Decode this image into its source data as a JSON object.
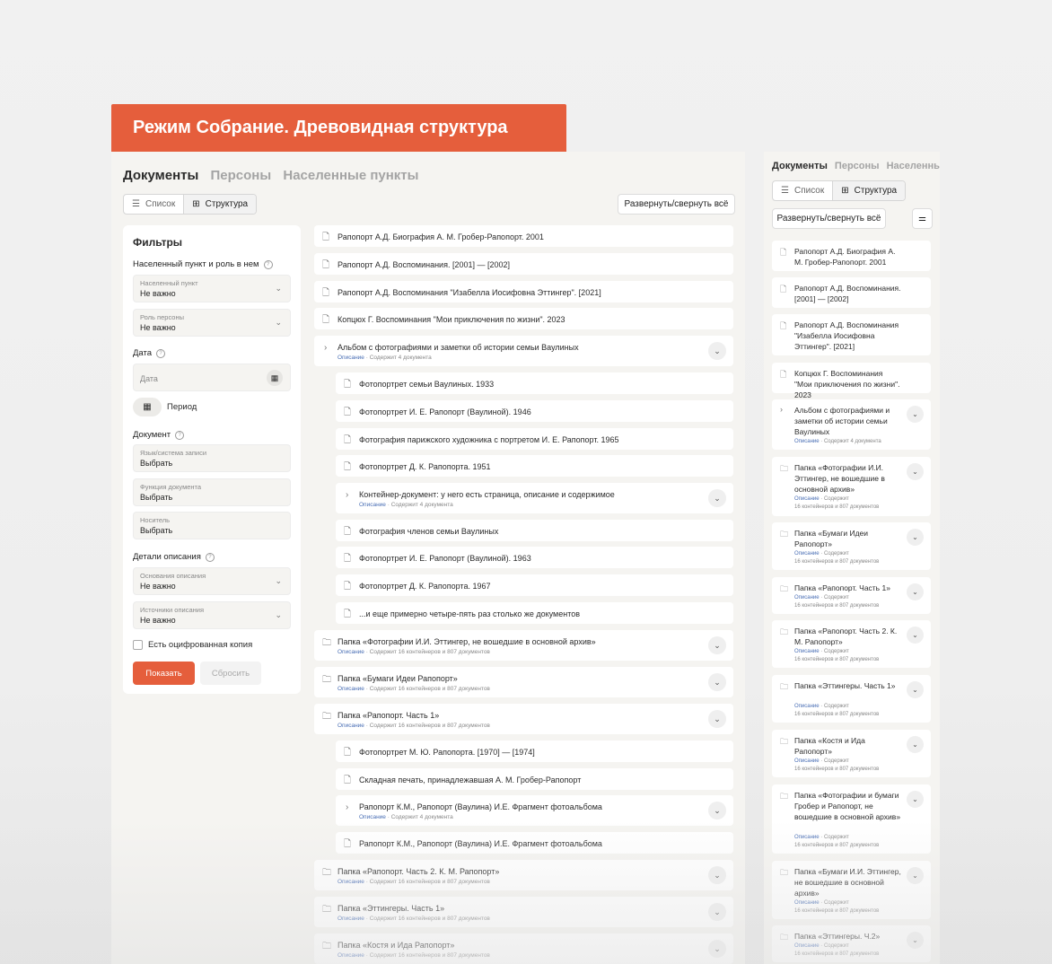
{
  "banner": {
    "title": "Режим Собрание. Древовидная структура"
  },
  "tabs": [
    "Документы",
    "Персоны",
    "Населенные пункты"
  ],
  "view_toggle": {
    "list": "Список",
    "structure": "Структура"
  },
  "expand_all": "Развернуть/свернуть всё",
  "filters": {
    "title": "Фильтры",
    "settlement_section": "Населенный пункт и роль в нем",
    "settlement": {
      "label": "Населенный пункт",
      "value": "Не важно"
    },
    "person_role": {
      "label": "Роль персоны",
      "value": "Не важно"
    },
    "date_section": "Дата",
    "date_placeholder": "Дата",
    "period": "Период",
    "document_section": "Документ",
    "language": {
      "label": "Язык/система записи",
      "value": "Выбрать"
    },
    "doc_function": {
      "label": "Функция документа",
      "value": "Выбрать"
    },
    "carrier": {
      "label": "Носитель",
      "value": "Выбрать"
    },
    "details_section": "Детали описания",
    "basis": {
      "label": "Основания описания",
      "value": "Не важно"
    },
    "sources": {
      "label": "Источники описания",
      "value": "Не важно"
    },
    "digital_copy": "Есть оцифрованная копия",
    "show": "Показать",
    "reset": "Сбросить"
  },
  "meta": {
    "desc": "Описание",
    "contains_4": "Содержит  4 документа",
    "contains_16": "Содержит  16 контейнеров  и  807 документов",
    "contains_short": "Содержит",
    "containers_docs": "16 контейнеров  и  807 документов"
  },
  "tree": [
    "Рапопорт А.Д. Биография А. М. Гробер-Рапопорт. 2001",
    "Рапопорт А.Д. Воспоминания. [2001] — [2002]",
    "Рапопорт А.Д. Воспоминания \"Изабелла Иосифовна Эттингер\". [2021]",
    "Копцюх Г. Воспоминания \"Мои приключения по жизни\". 2023",
    "Альбом с фотографиями и заметки об истории семьи Ваулиных",
    "Фотопортрет семьи Ваулиных. 1933",
    "Фотопортрет И. Е. Рапопорт (Ваулиной). 1946",
    "Фотография парижского художника с портретом И. Е. Рапопорт. 1965",
    "Фотопортрет Д. К. Рапопорта. 1951",
    "Контейнер-документ: у него есть страница, описание и содержимое",
    "Фотография членов семьи Ваулиных",
    "Фотопортрет И. Е. Рапопорт (Ваулиной). 1963",
    "Фотопортрет Д. К. Рапопорта. 1967",
    "...и еще примерно четыре-пять раз столько же документов",
    "Папка «Фотографии И.И. Эттингер, не вошедшие в основной архив»",
    "Папка «Бумаги Идеи Рапопорт»",
    "Папка «Рапопорт. Часть 1»",
    "Фотопортрет М. Ю. Рапопорта. [1970] — [1974]",
    "Складная печать, принадлежавшая А. М. Гробер-Рапопорт",
    "Рапопорт К.М., Рапопорт (Ваулина) И.Е. Фрагмент фотоальбома",
    "Рапопорт К.М., Рапопорт (Ваулина) И.Е. Фрагмент фотоальбома",
    "Папка «Рапопорт. Часть 2. К. М. Рапопорт»",
    "Папка «Эттингеры. Часть 1»",
    "Папка «Костя и Ида Рапопорт»"
  ],
  "side_tree": [
    "Рапопорт А.Д. Биография А. М. Гробер-Рапопорт. 2001",
    "Рапопорт А.Д. Воспоминания. [2001] — [2002]",
    "Рапопорт А.Д. Воспоминания \"Изабелла Иосифовна Эттингер\". [2021]",
    "Копцюх Г. Воспоминания \"Мои приключения по жизни\". 2023",
    "Альбом с фотографиями и заметки об истории семьи Ваулиных",
    "Папка «Фотографии И.И. Эттингер, не вошедшие в основной архив»",
    "Папка «Бумаги Идеи Рапопорт»",
    "Папка «Рапопорт. Часть 1»",
    "Папка «Рапопорт. Часть 2. К. М. Рапопорт»",
    "Папка «Эттингеры. Часть 1»",
    "Папка «Костя и Ида Рапопорт»",
    "Папка «Фотографии и бумаги Гробер и Рапопорт, не вошедшие в основной архив»",
    "Папка «Бумаги И.И. Эттингер, не вошедшие в основной архив»",
    "Папка «Эттингеры. Ч.2»"
  ],
  "colors": {
    "accent": "#e55e3c",
    "link": "#4a6fb5",
    "panel": "#f5f4f1"
  }
}
